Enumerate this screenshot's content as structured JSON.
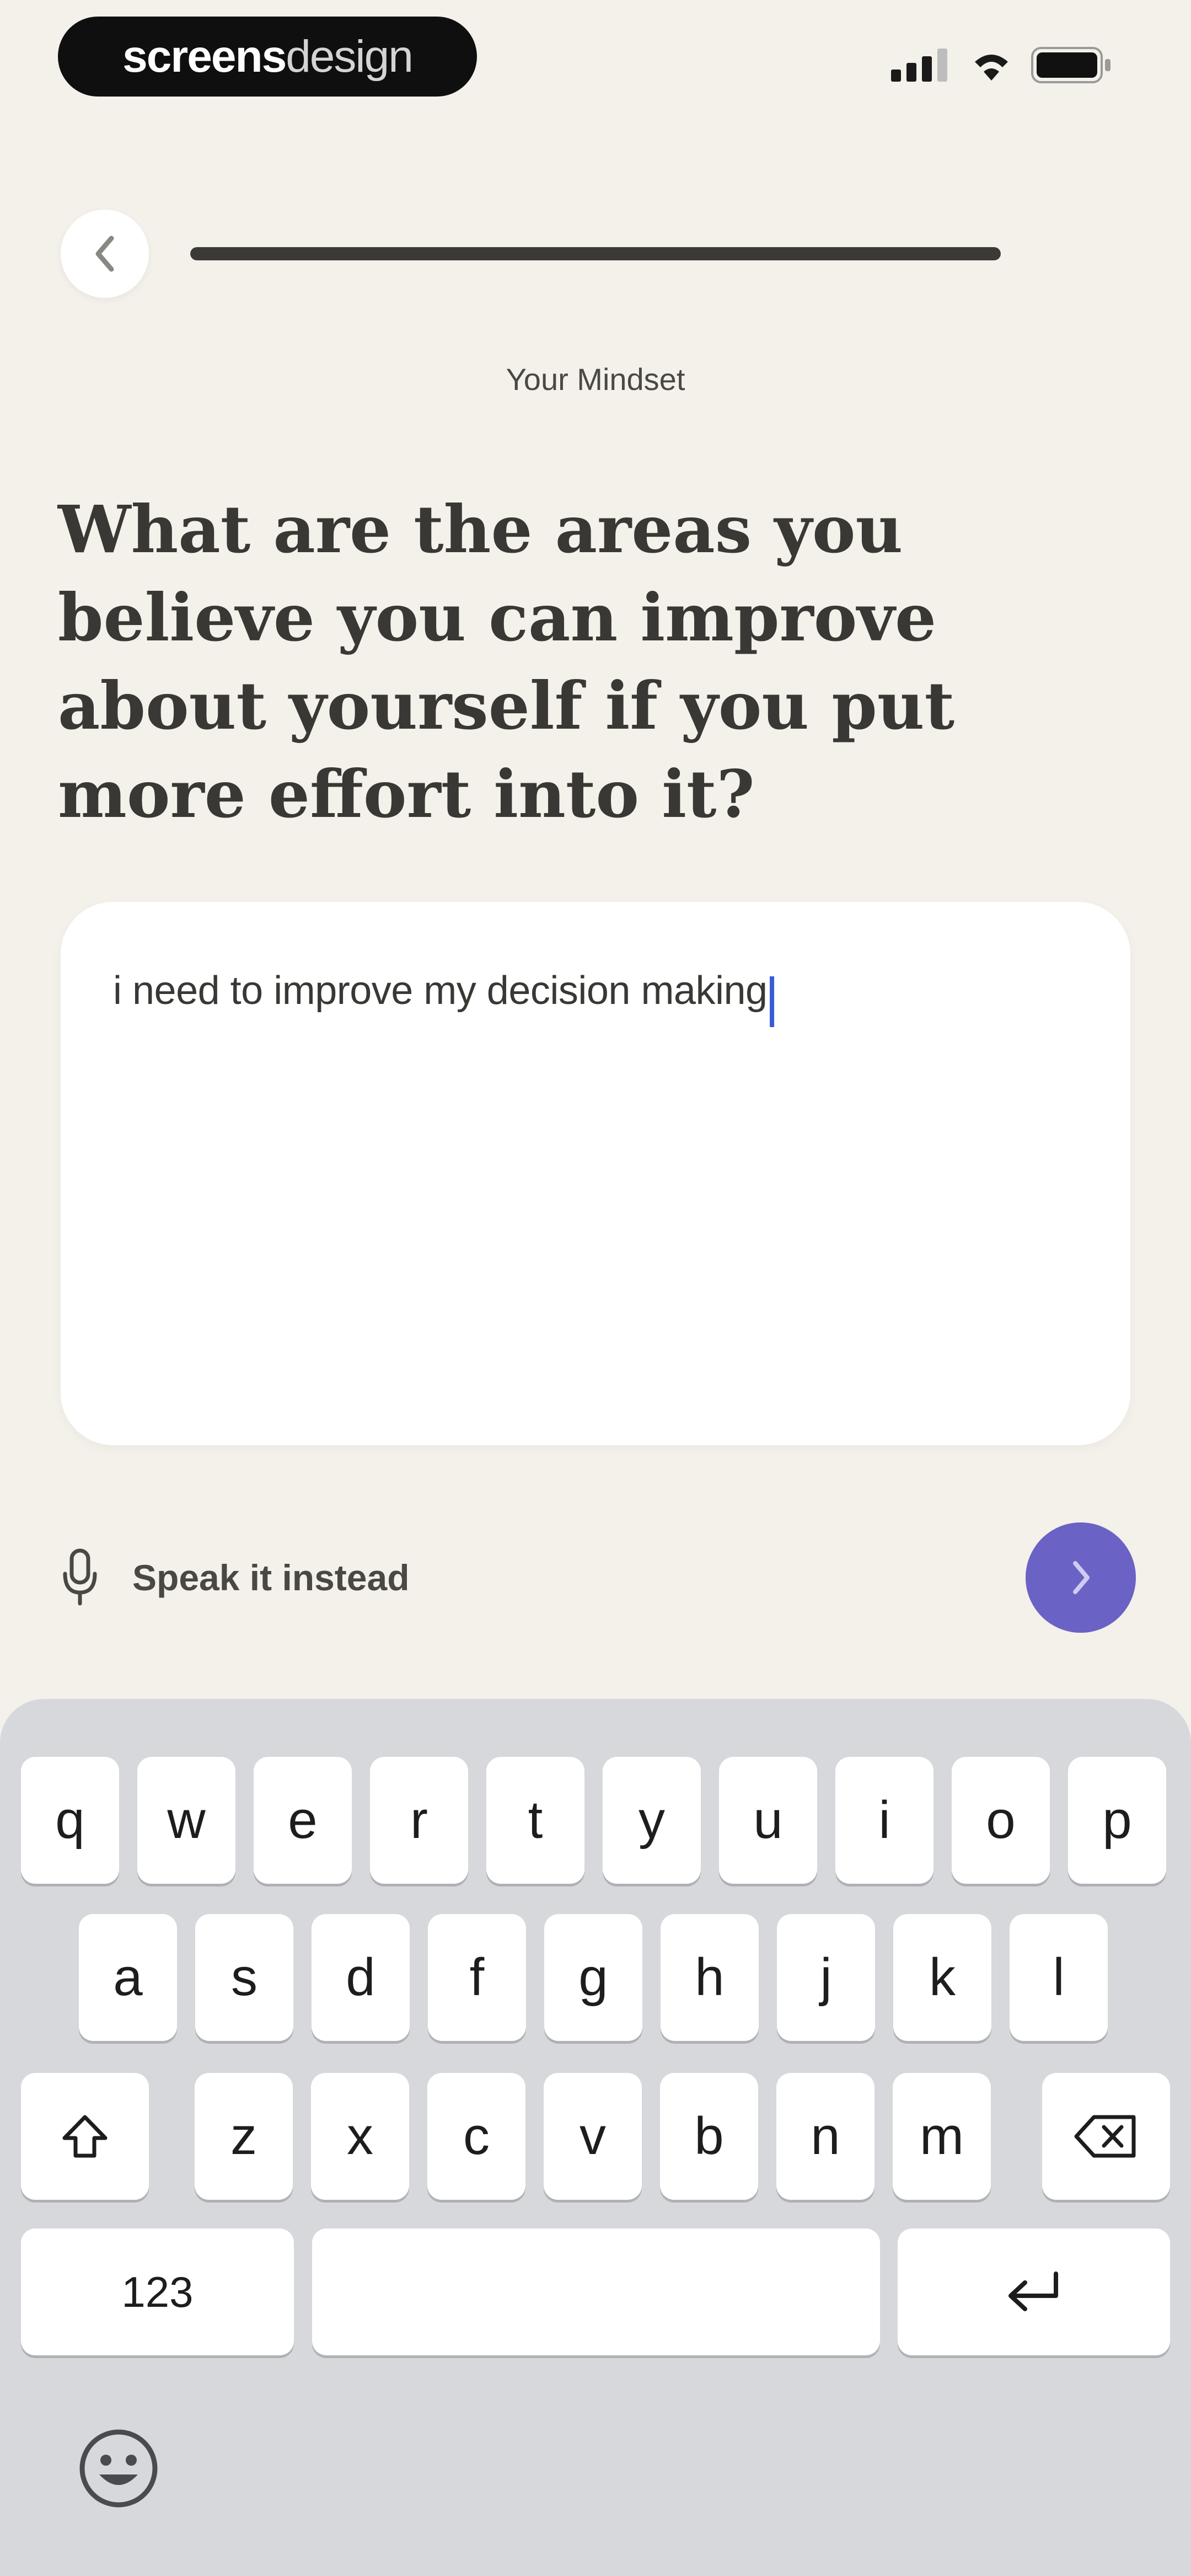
{
  "status_bar": {
    "brand_bold": "screens",
    "brand_light": "design"
  },
  "nav": {
    "progress_percent": 100
  },
  "section_label": "Your Mindset",
  "question": "What are the areas you believe you can improve about yourself if you put more effort into it?",
  "answer": {
    "value": "i need to improve my decision making"
  },
  "speak": {
    "label": "Speak it instead"
  },
  "colors": {
    "background": "#f3f1ea",
    "accent": "#6a62c4",
    "progress": "#3b3a36",
    "caret": "#3a5bd9"
  },
  "keyboard": {
    "row1": [
      "q",
      "w",
      "e",
      "r",
      "t",
      "y",
      "u",
      "i",
      "o",
      "p"
    ],
    "row2": [
      "a",
      "s",
      "d",
      "f",
      "g",
      "h",
      "j",
      "k",
      "l"
    ],
    "row3": [
      "z",
      "x",
      "c",
      "v",
      "b",
      "n",
      "m"
    ],
    "numbers_key": "123"
  }
}
